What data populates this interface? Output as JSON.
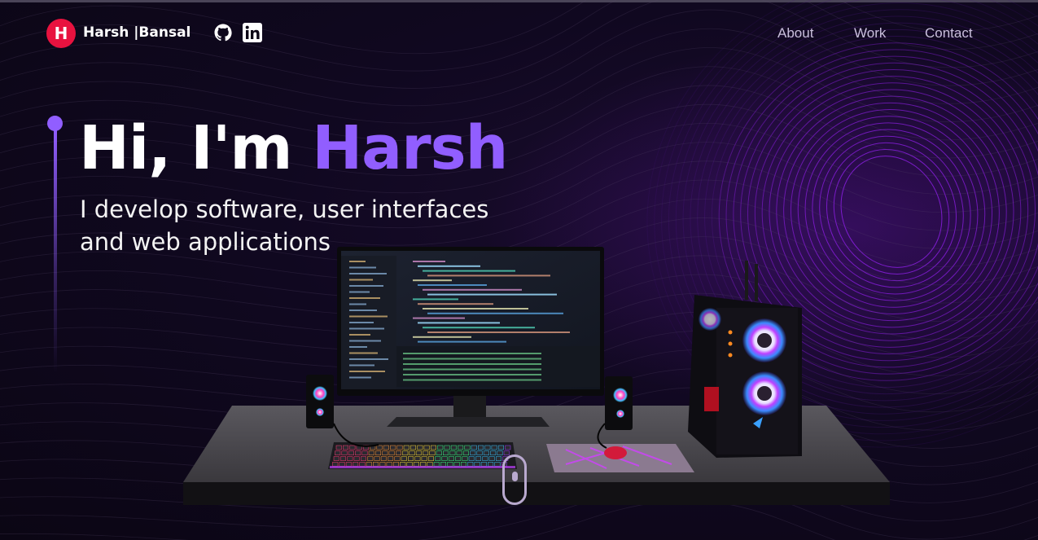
{
  "nav": {
    "logo_letter": "H",
    "brand": "Harsh |Bansal",
    "links": [
      {
        "label": "About"
      },
      {
        "label": "Work"
      },
      {
        "label": "Contact"
      }
    ],
    "social": [
      "github-icon",
      "linkedin-icon"
    ]
  },
  "hero": {
    "title_prefix": "Hi, I'm ",
    "title_highlight": "Harsh",
    "subtitle": "I develop software, user interfaces and web applications"
  },
  "colors": {
    "accent": "#915eff",
    "logo": "#e8123f",
    "background": "#0d0716"
  },
  "scroll_indicator": "mouse-scroll-icon"
}
